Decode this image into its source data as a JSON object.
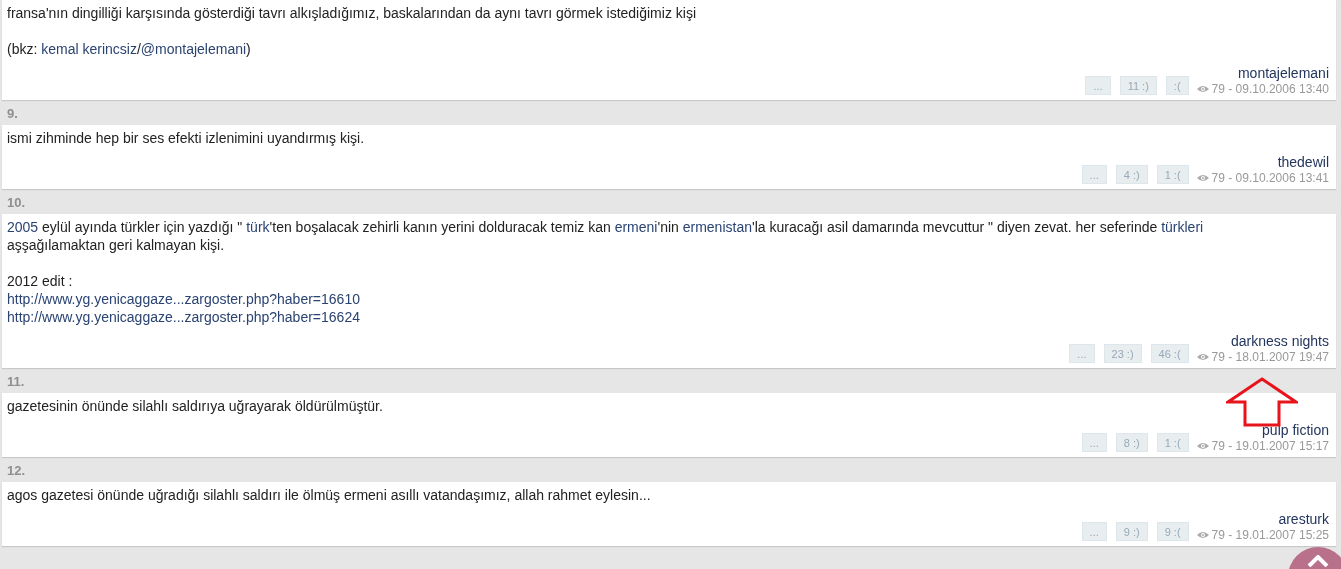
{
  "entries": [
    {
      "blocks": [
        [
          [
            {
              "kind": "text",
              "text": "fransa'nın dingilliği karşısında gösterdiği tavrı alkışladığımız, baskalarından da aynı tavrı görmek istediğimiz kişi"
            }
          ]
        ],
        [
          [
            {
              "kind": "text",
              "text": "(bkz: "
            },
            {
              "kind": "link",
              "text": "kemal kerincsiz"
            },
            {
              "kind": "text",
              "text": "/"
            },
            {
              "kind": "link",
              "text": "@montajelemani"
            },
            {
              "kind": "text",
              "text": ")"
            }
          ]
        ]
      ],
      "buttons": [
        "...",
        "11 :)",
        ":("
      ],
      "author": "montajelemani",
      "meta": "79 - 09.10.2006 13:40"
    },
    {
      "number": "9.",
      "blocks": [
        [
          [
            {
              "kind": "text",
              "text": "ismi zihminde hep bir ses efekti izlenimini uyandırmış kişi."
            }
          ]
        ]
      ],
      "buttons": [
        "...",
        "4 :)",
        "1 :("
      ],
      "author": "thedewil",
      "meta": "79 - 09.10.2006 13:41"
    },
    {
      "number": "10.",
      "blocks": [
        [
          [
            {
              "kind": "link",
              "text": "2005"
            },
            {
              "kind": "text",
              "text": " eylül ayında türkler için yazdığı \" "
            },
            {
              "kind": "link",
              "text": "türk"
            },
            {
              "kind": "text",
              "text": "'ten boşalacak zehirli kanın yerini dolduracak temiz kan "
            },
            {
              "kind": "link",
              "text": "ermeni"
            },
            {
              "kind": "text",
              "text": "'nin "
            },
            {
              "kind": "link",
              "text": "ermenistan"
            },
            {
              "kind": "text",
              "text": "'la kuracağı asil damarında mevcuttur \" diyen zevat. her seferinde "
            },
            {
              "kind": "link",
              "text": "türkleri"
            },
            {
              "kind": "text",
              "text": " aşşağılamaktan geri kalmayan kişi."
            }
          ]
        ],
        [
          [
            {
              "kind": "text",
              "text": "2012 edit :"
            }
          ],
          [
            {
              "kind": "link",
              "text": "http://www.yg.yenicaggaze...zargoster.php?haber=16610"
            }
          ],
          [
            {
              "kind": "link",
              "text": "http://www.yg.yenicaggaze...zargoster.php?haber=16624"
            }
          ]
        ]
      ],
      "buttons": [
        "...",
        "23 :)",
        "46 :("
      ],
      "author": "darkness nights",
      "meta": "79 - 18.01.2007 19:47"
    },
    {
      "number": "11.",
      "blocks": [
        [
          [
            {
              "kind": "text",
              "text": "gazetesinin önünde silahlı saldırıya uğrayarak öldürülmüştür."
            }
          ]
        ]
      ],
      "buttons": [
        "...",
        "8 :)",
        "1 :("
      ],
      "author": "pulp fiction",
      "meta": "79 - 19.01.2007 15:17"
    },
    {
      "number": "12.",
      "blocks": [
        [
          [
            {
              "kind": "text",
              "text": "agos gazetesi önünde uğradığı silahlı saldırı ile ölmüş ermeni asıllı vatandaşımız, allah rahmet eylesin..."
            }
          ]
        ]
      ],
      "buttons": [
        "...",
        "9 :)",
        "9 :("
      ],
      "author": "aresturk",
      "meta": "79 - 19.01.2007 15:25"
    }
  ]
}
